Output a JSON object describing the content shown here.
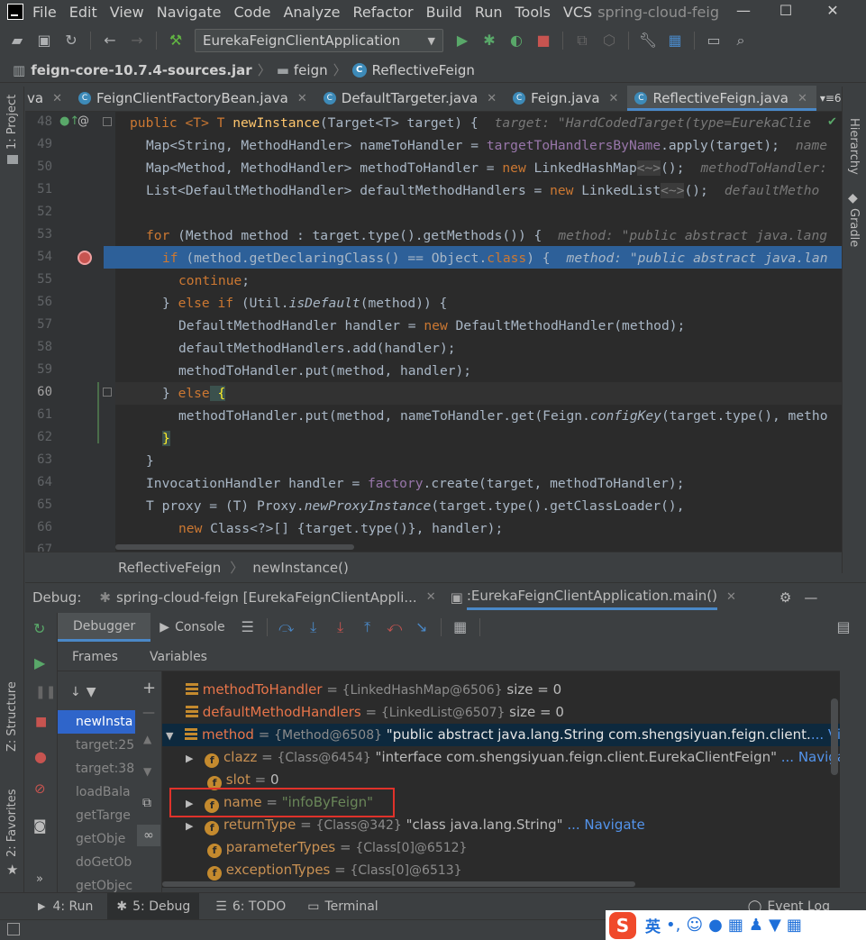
{
  "menubar": {
    "items": [
      {
        "label": "File"
      },
      {
        "label": "Edit"
      },
      {
        "label": "View"
      },
      {
        "label": "Navigate"
      },
      {
        "label": "Code"
      },
      {
        "label": "Analyze"
      },
      {
        "label": "Refactor"
      },
      {
        "label": "Build"
      },
      {
        "label": "Run"
      },
      {
        "label": "Tools"
      },
      {
        "label": "VCS"
      }
    ],
    "project_title": "spring-cloud-feig"
  },
  "toolbar": {
    "run_config": "EurekaFeignClientApplication"
  },
  "breadcrumb": {
    "jar": "feign-core-10.7.4-sources.jar",
    "package": "feign",
    "class": "ReflectiveFeign"
  },
  "left_strip": {
    "project": "1: Project",
    "structure": "Z: Structure",
    "favorites": "2: Favorites"
  },
  "right_strip": {
    "hierarchy": "Hierarchy",
    "gradle": "Gradle"
  },
  "tabs": [
    {
      "label": "va"
    },
    {
      "label": "FeignClientFactoryBean.java"
    },
    {
      "label": "DefaultTargeter.java"
    },
    {
      "label": "Feign.java"
    },
    {
      "label": "ReflectiveFeign.java"
    }
  ],
  "tabs_overflow": "6",
  "code": {
    "line_numbers": [
      "48",
      "49",
      "50",
      "51",
      "52",
      "53",
      "54",
      "55",
      "56",
      "57",
      "58",
      "59",
      "60",
      "61",
      "62",
      "63",
      "64",
      "65",
      "66",
      "67"
    ],
    "l48": {
      "a": "public <T> T ",
      "fn": "newInstance",
      "b": "(Target<T> target) {",
      "hint": "target: \"HardCodedTarget(type=EurekaClie"
    },
    "l49": {
      "a": "Map<String, MethodHandler> nameToHandler = ",
      "fld": "targetToHandlersByName",
      "b": ".apply(target);",
      "hint": "name"
    },
    "l50": {
      "a": "Map<Method, MethodHandler> methodToHandler = ",
      "kw": "new",
      "b": " LinkedHashMap",
      "g": "<~>",
      "c": "();",
      "hint": "methodToHandler:"
    },
    "l51": {
      "a": "List<DefaultMethodHandler> defaultMethodHandlers = ",
      "kw": "new",
      "b": " LinkedList",
      "g": "<~>",
      "c": "();",
      "hint": "defaultMetho"
    },
    "l53": {
      "kw": "for",
      "a": " (Method method : target.type().getMethods()) {",
      "hint": "method: \"public abstract java.lang"
    },
    "l54": {
      "kw": "if",
      "a": " (method.getDeclaringClass() == Object.",
      "kw2": "class",
      "b": ") {",
      "hint": "method: \"public abstract java.lan"
    },
    "l55": {
      "kw": "continue",
      "a": ";"
    },
    "l56": {
      "a": "} ",
      "kw": "else if",
      "b": " (Util.",
      "it": "isDefault",
      "c": "(method)) {"
    },
    "l57": {
      "a": "DefaultMethodHandler handler = ",
      "kw": "new",
      "b": " DefaultMethodHandler(method);"
    },
    "l58": {
      "a": "defaultMethodHandlers.add(handler);"
    },
    "l59": {
      "a": "methodToHandler.put(method, handler);"
    },
    "l60": {
      "a": "} ",
      "kw": "else",
      "b": " {"
    },
    "l61": {
      "a": "methodToHandler.put(method, nameToHandler.get(Feign.",
      "it": "configKey",
      "b": "(target.type(), metho"
    },
    "l62": {
      "a": "}"
    },
    "l63": {
      "a": "}"
    },
    "l64": {
      "a": "InvocationHandler handler = ",
      "fld": "factory",
      "b": ".create(target, methodToHandler);"
    },
    "l65": {
      "a": "T proxy = (T) Proxy.",
      "it": "newProxyInstance",
      "b": "(target.type().getClassLoader(),"
    },
    "l66": {
      "kw": "new",
      "a": " Class<?>[] {target.type()}, handler);"
    }
  },
  "editor_breadcrumb": {
    "class": "ReflectiveFeign",
    "method": "newInstance()"
  },
  "debug": {
    "label": "Debug:",
    "session1": "spring-cloud-feign [EurekaFeignClientAppli...",
    "session2": ":EurekaFeignClientApplication.main()",
    "tab_debugger": "Debugger",
    "tab_console": "Console",
    "frames_header": "Frames",
    "variables_header": "Variables",
    "frames": [
      "newInsta",
      "target:25",
      "target:38",
      "loadBala",
      "getTarge",
      "getObje",
      "doGetOb",
      "getObjec"
    ]
  },
  "variables": [
    {
      "name": "methodToHandler",
      "eq": " = ",
      "type": "{LinkedHashMap@6506}",
      "value": " size = 0"
    },
    {
      "name": "defaultMethodHandlers",
      "eq": " = ",
      "type": "{LinkedList@6507}",
      "value": " size = 0"
    },
    {
      "name": "method",
      "eq": " = ",
      "type": "{Method@6508}",
      "value": " \"public abstract java.lang.String com.shengsiyuan.feign.client.",
      "nav": "... View"
    },
    {
      "name": "clazz",
      "eq": " = ",
      "type": "{Class@6454}",
      "value": " \"interface com.shengsiyuan.feign.client.EurekaClientFeign\"",
      "nav": " ... Navigate"
    },
    {
      "name": "slot",
      "eq": " = ",
      "value": "0"
    },
    {
      "name": "name",
      "eq": " = ",
      "str": "\"infoByFeign\""
    },
    {
      "name": "returnType",
      "eq": " = ",
      "type": "{Class@342}",
      "value": " \"class java.lang.String\"",
      "nav": " ... Navigate"
    },
    {
      "name": "parameterTypes",
      "eq": " = ",
      "type": "{Class[0]@6512}"
    },
    {
      "name": "exceptionTypes",
      "eq": " = ",
      "type": "{Class[0]@6513}"
    }
  ],
  "bottom_tabs": {
    "run": "4: Run",
    "debug": "5: Debug",
    "todo": "6: TODO",
    "terminal": "Terminal",
    "event_log": "Event Log"
  },
  "ime": {
    "lang": "英"
  },
  "colors": {
    "accent": "#4a88c7",
    "highlight_line": "#2d6099",
    "name_box": "#e0322a"
  }
}
